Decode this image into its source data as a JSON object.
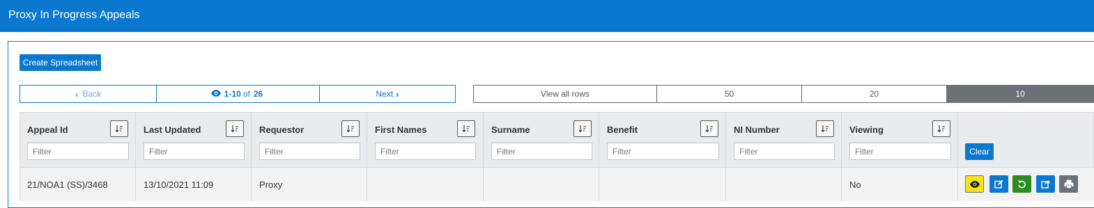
{
  "header": {
    "title": "Proxy In Progress Appeals"
  },
  "toolbar": {
    "create_label": "Create Spreadsheet"
  },
  "pager": {
    "back_label": "Back",
    "range": "1-10",
    "of_label": "of",
    "total": "26",
    "next_label": "Next"
  },
  "rows_per_page": {
    "options": [
      "View all rows",
      "50",
      "20",
      "10"
    ],
    "selected": "10"
  },
  "table": {
    "columns": [
      {
        "label": "Appeal Id",
        "filter_placeholder": "Filter"
      },
      {
        "label": "Last Updated",
        "filter_placeholder": "Filter"
      },
      {
        "label": "Requestor",
        "filter_placeholder": "Filter"
      },
      {
        "label": "First Names",
        "filter_placeholder": "Filter"
      },
      {
        "label": "Surname",
        "filter_placeholder": "Filter"
      },
      {
        "label": "Benefit",
        "filter_placeholder": "Filter"
      },
      {
        "label": "NI Number",
        "filter_placeholder": "Filter"
      },
      {
        "label": "Viewing",
        "filter_placeholder": "Filter"
      }
    ],
    "clear_label": "Clear",
    "rows": [
      {
        "appeal_id": "21/NOA1 (SS)/3468",
        "last_updated": "13/10/2021 11:09",
        "requestor": "Proxy",
        "first_names": "",
        "surname": "",
        "benefit": "",
        "ni_number": "",
        "viewing": "No",
        "actions": [
          "view-icon",
          "edit-icon",
          "undo-icon",
          "share-icon",
          "print-icon"
        ]
      }
    ]
  },
  "colors": {
    "brand": "#0b78cf",
    "view_action": "#f4e31b",
    "undo_action": "#2e8b1d",
    "selected_rows": "#6a7177"
  }
}
